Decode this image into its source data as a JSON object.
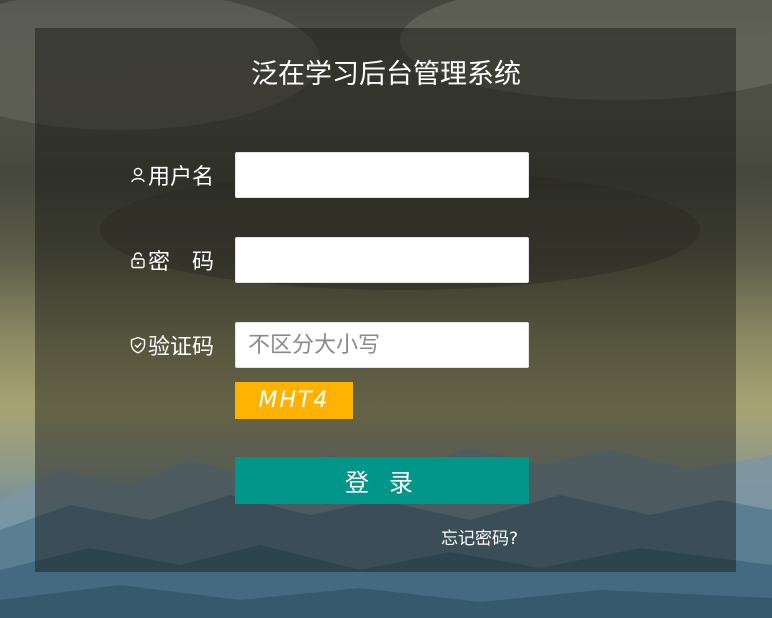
{
  "app": {
    "title": "泛在学习后台管理系统"
  },
  "form": {
    "username": {
      "label": "用户名",
      "icon": "user-icon",
      "value": "",
      "placeholder": ""
    },
    "password": {
      "label": "密　码",
      "icon": "lock-icon",
      "value": "",
      "placeholder": ""
    },
    "captcha": {
      "label": "验证码",
      "icon": "shield-icon",
      "value": "",
      "placeholder": "不区分大小写",
      "code": "MHT4"
    },
    "login_label": "登录",
    "forgot_label": "忘记密码?"
  },
  "colors": {
    "login_button": "#00968a",
    "captcha_background": "#ffb300",
    "panel_overlay": "rgba(20,20,16,0.45)"
  }
}
